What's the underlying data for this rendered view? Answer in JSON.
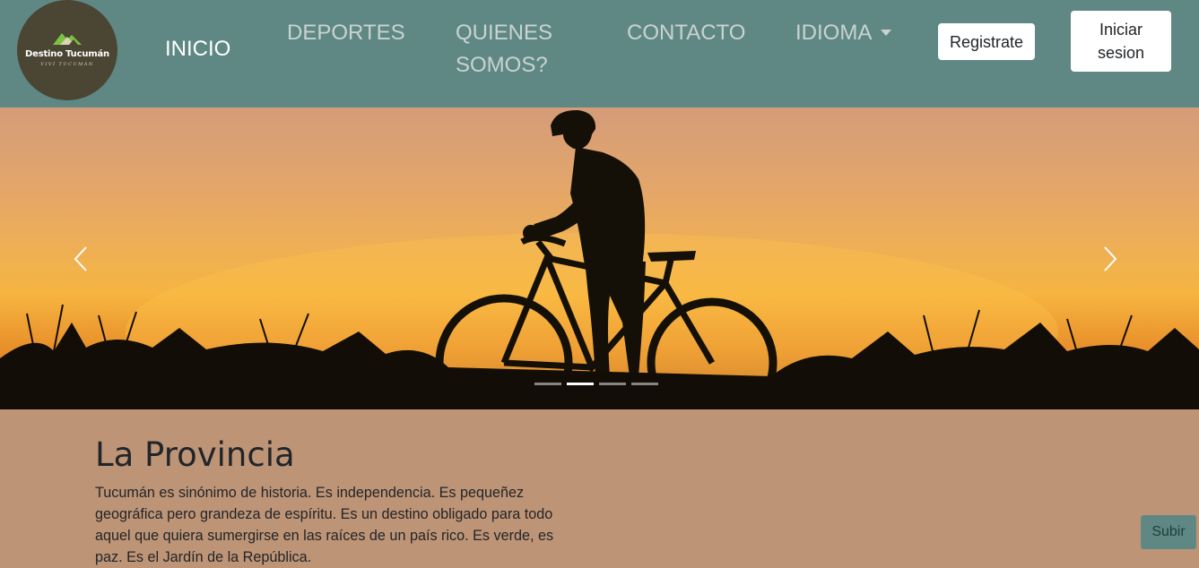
{
  "brand": {
    "name": "Destino Tucumán",
    "tagline": "VIVÍ TUCUMÁN",
    "mountain-icon": "mountain-icon"
  },
  "nav": {
    "items": [
      {
        "label": "INICIO",
        "active": true
      },
      {
        "label": "DEPORTES",
        "active": false
      },
      {
        "label": "QUIENES SOMOS?",
        "active": false
      },
      {
        "label": "CONTACTO",
        "active": false
      },
      {
        "label": "IDIOMA",
        "active": false,
        "dropdown": true
      }
    ],
    "register_label": "Registrate",
    "login_label": "Iniciar sesion"
  },
  "carousel": {
    "image_subject": "cyclist-silhouette-sunset",
    "prev_icon": "chevron-left-icon",
    "next_icon": "chevron-right-icon",
    "slide_count": 4,
    "active_index": 1
  },
  "main": {
    "title": "La Provincia",
    "text": "Tucumán es sinónimo de historia. Es independencia. Es pequeñez geográfica pero grandeza de espíritu. Es un destino obligado para todo aquel que quiera sumergirse en las raíces de un país rico. Es verde, es paz. Es el Jardín de la República."
  },
  "scroll_top": {
    "label": "Subir"
  },
  "colors": {
    "navbar": "#5f8884",
    "content_bg": "#be9476",
    "logo_bg": "#4a4633",
    "text": "#212529"
  }
}
